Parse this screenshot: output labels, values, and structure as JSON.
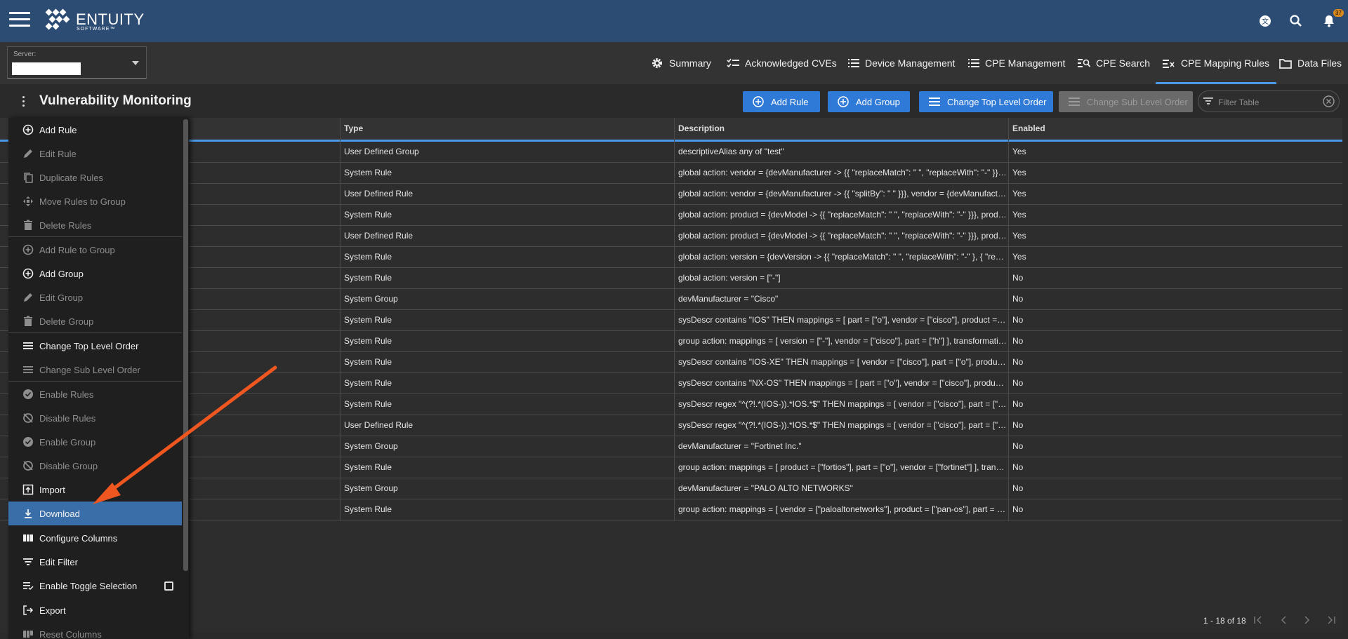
{
  "app": {
    "brand": "ENTUITY",
    "brand_sub": "SOFTWARE™",
    "notification_count": "37"
  },
  "server": {
    "label": "Server:",
    "value": ""
  },
  "nav_tabs": [
    {
      "label": "Summary",
      "icon": "gear-icon"
    },
    {
      "label": "Acknowledged CVEs",
      "icon": "checklist-icon"
    },
    {
      "label": "Device Management",
      "icon": "list-icon"
    },
    {
      "label": "CPE Management",
      "icon": "list-icon"
    },
    {
      "label": "CPE Search",
      "icon": "search-list-icon"
    },
    {
      "label": "CPE Mapping Rules",
      "icon": "mapping-icon",
      "active": true
    },
    {
      "label": "Data Files",
      "icon": "folder-icon"
    }
  ],
  "page": {
    "title": "Vulnerability Monitoring"
  },
  "toolbar": {
    "add_rule": "Add Rule",
    "add_group": "Add Group",
    "change_top": "Change Top Level Order",
    "change_sub": "Change Sub Level Order",
    "filter_placeholder": "Filter Table"
  },
  "table": {
    "columns": [
      "Type",
      "Description",
      "Enabled"
    ],
    "rows": [
      {
        "type": "User Defined Group",
        "description": "descriptiveAlias any of \"test\"",
        "enabled": "Yes"
      },
      {
        "type": "System Rule",
        "description": "global action: vendor = {devManufacturer -> {{ \"replaceMatch\": \" \", \"replaceWith\": \"-\" }}, vendor = {devManufacturer -> {{ \"replaceMatch\": \"-\" }}}",
        "enabled": "Yes"
      },
      {
        "type": "User Defined Rule",
        "description": "global action: vendor = {devManufacturer -> {{ \"splitBy\": \" \" }}}, vendor = {devManufacturer -> {{ \"splitBy\": \" \" }}}",
        "enabled": "Yes"
      },
      {
        "type": "System Rule",
        "description": "global action: product = {devModel -> {{ \"replaceMatch\": \" \", \"replaceWith\": \"-\" }}}, product = {devModel}",
        "enabled": "Yes"
      },
      {
        "type": "User Defined Rule",
        "description": "global action: product = {devModel -> {{ \"replaceMatch\": \" \", \"replaceWith\": \"-\" }}}, product = {devModel}",
        "enabled": "Yes"
      },
      {
        "type": "System Rule",
        "description": "global action: version = {devVersion -> {{ \"replaceMatch\": \" \", \"replaceWith\": \"-\" }, { \"replaceMatch\" }}}",
        "enabled": "Yes"
      },
      {
        "type": "System Rule",
        "description": "global action: version = [\"-\"]",
        "enabled": "No"
      },
      {
        "type": "System Group",
        "description": "devManufacturer = \"Cisco\"",
        "enabled": "No"
      },
      {
        "type": "System Rule",
        "description": "sysDescr contains \"IOS\" THEN mappings = [ part = [\"o\"], vendor = [\"cisco\"], product = [\"ios\"] ]",
        "enabled": "No"
      },
      {
        "type": "System Rule",
        "description": "group action: mappings = [ version = [\"-\"], vendor = [\"cisco\"], part = [\"h\"] ], transformations = []",
        "enabled": "No"
      },
      {
        "type": "System Rule",
        "description": "sysDescr contains \"IOS-XE\" THEN mappings = [ vendor = [\"cisco\"], part = [\"o\"], product = [\"ios_xe\"] ]",
        "enabled": "No"
      },
      {
        "type": "System Rule",
        "description": "sysDescr contains \"NX-OS\" THEN mappings = [ part = [\"o\"], vendor = [\"cisco\"], product = [\"nx-os\"] ]",
        "enabled": "No"
      },
      {
        "type": "System Rule",
        "description": "sysDescr regex \"^(?!.*(IOS-)).*IOS.*$\" THEN mappings = [ vendor = [\"cisco\"], part = [\"o\"], product = [\"ios\"] ]",
        "enabled": "No"
      },
      {
        "type": "User Defined Rule",
        "description": "sysDescr regex \"^(?!.*(IOS-)).*IOS.*$\" THEN mappings = [ vendor = [\"cisco\"], part = [\"o\"], product = [\"ios\"] ]",
        "enabled": "No"
      },
      {
        "type": "System Group",
        "description": "devManufacturer = \"Fortinet Inc.\"",
        "enabled": "No"
      },
      {
        "type": "System Rule",
        "description": "group action: mappings = [ product = [\"fortios\"], part = [\"o\"], vendor = [\"fortinet\"] ], transformations = []",
        "enabled": "No"
      },
      {
        "type": "System Group",
        "description": "devManufacturer = \"PALO ALTO NETWORKS\"",
        "enabled": "No"
      },
      {
        "type": "System Rule",
        "description": "group action: mappings = [ vendor = [\"paloaltonetworks\"], product = [\"pan-os\"], part = [\"o\"] ]",
        "enabled": "No"
      }
    ]
  },
  "pagination": {
    "range": "1 - 18 of 18"
  },
  "menu": {
    "items": [
      {
        "label": "Add Rule",
        "icon": "add-circle-icon",
        "enabled": true
      },
      {
        "label": "Edit Rule",
        "icon": "pencil-icon",
        "enabled": false
      },
      {
        "label": "Duplicate Rules",
        "icon": "copy-icon",
        "enabled": false
      },
      {
        "label": "Move Rules to Group",
        "icon": "move-icon",
        "enabled": false
      },
      {
        "label": "Delete Rules",
        "icon": "trash-icon",
        "enabled": false
      },
      {
        "label": "Add Rule to Group",
        "icon": "add-circle-icon",
        "enabled": false
      },
      {
        "label": "Add Group",
        "icon": "add-circle-icon",
        "enabled": true
      },
      {
        "label": "Edit Group",
        "icon": "pencil-icon",
        "enabled": false
      },
      {
        "label": "Delete Group",
        "icon": "trash-icon",
        "enabled": false
      },
      {
        "label": "Change Top Level Order",
        "icon": "reorder-icon",
        "enabled": true
      },
      {
        "label": "Change Sub Level Order",
        "icon": "reorder-icon",
        "enabled": false
      },
      {
        "label": "Enable Rules",
        "icon": "check-circle-icon",
        "enabled": false
      },
      {
        "label": "Disable Rules",
        "icon": "disable-icon",
        "enabled": false
      },
      {
        "label": "Enable Group",
        "icon": "check-circle-icon",
        "enabled": false
      },
      {
        "label": "Disable Group",
        "icon": "disable-icon",
        "enabled": false
      },
      {
        "label": "Import",
        "icon": "import-icon",
        "enabled": true
      },
      {
        "label": "Download",
        "icon": "download-icon",
        "enabled": true,
        "highlighted": true
      },
      {
        "label": "Configure Columns",
        "icon": "columns-icon",
        "enabled": true
      },
      {
        "label": "Edit Filter",
        "icon": "filter-icon",
        "enabled": true
      },
      {
        "label": "Enable Toggle Selection",
        "icon": "toggle-list-icon",
        "enabled": true,
        "checkbox": true
      },
      {
        "label": "Export",
        "icon": "export-icon",
        "enabled": true
      },
      {
        "label": "Reset Columns",
        "icon": "columns-reset-icon",
        "enabled": false
      }
    ]
  },
  "colors": {
    "topbar": "#2c4c74",
    "accent": "#2f7ad6",
    "highlight": "#3a6ea8",
    "arrow": "#f0561f"
  }
}
